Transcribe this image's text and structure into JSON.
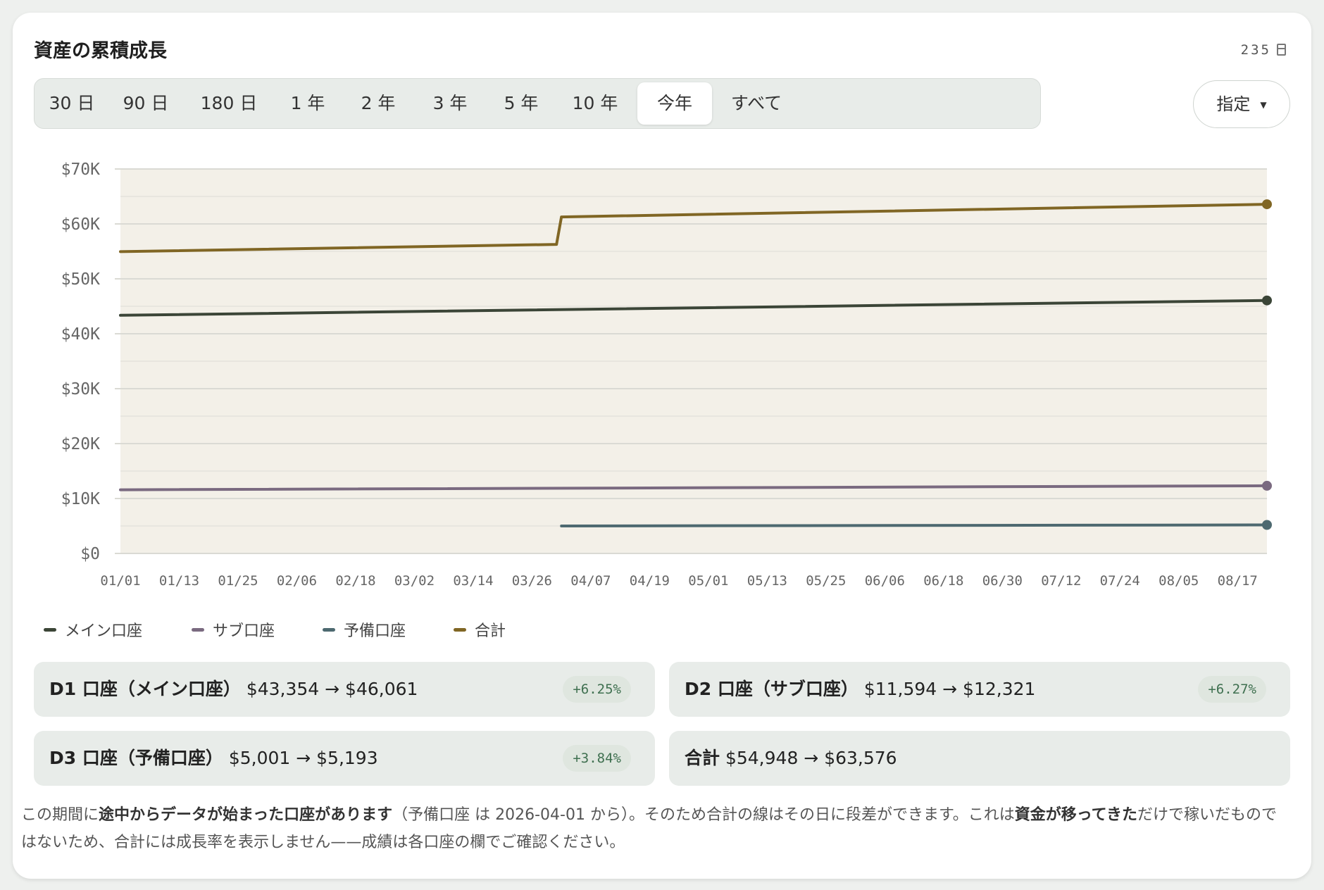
{
  "header": {
    "title": "資産の累積成長",
    "day_count": "235"
  },
  "range_tabs": [
    {
      "label": "30 日"
    },
    {
      "label": "90 日"
    },
    {
      "label": "180 日"
    },
    {
      "label": "1 年"
    },
    {
      "label": "2 年"
    },
    {
      "label": "3 年"
    },
    {
      "label": "5 年"
    },
    {
      "label": "10 年"
    },
    {
      "label": "今年",
      "active": true
    },
    {
      "label": "すべて"
    }
  ],
  "custom_button": {
    "label": "指定"
  },
  "colors": {
    "main": "#3b4537",
    "sub": "#7a6a80",
    "backup": "#4d6970",
    "total": "#806624",
    "fill": "#f3f0e8",
    "grid": "#dadad4"
  },
  "legend": [
    {
      "label": "メイン口座",
      "color": "#3b4537"
    },
    {
      "label": "サブ口座",
      "color": "#7a6a80"
    },
    {
      "label": "予備口座",
      "color": "#4d6970"
    },
    {
      "label": "合計",
      "color": "#806624"
    }
  ],
  "chart_data": {
    "type": "line",
    "ylim": [
      0,
      70000
    ],
    "y_ticks": [
      "$0",
      "$10K",
      "$20K",
      "$30K",
      "$40K",
      "$50K",
      "$60K",
      "$70K"
    ],
    "y_tick_values": [
      0,
      10000,
      20000,
      30000,
      40000,
      50000,
      60000,
      70000
    ],
    "x_ticks": [
      "01/01",
      "01/13",
      "01/25",
      "02/06",
      "02/18",
      "03/02",
      "03/14",
      "03/26",
      "04/07",
      "04/19",
      "05/01",
      "05/13",
      "05/25",
      "06/06",
      "06/18",
      "06/30",
      "07/12",
      "07/24",
      "08/05",
      "08/17"
    ],
    "grid": true,
    "series": [
      {
        "name": "メイン口座",
        "points": [
          [
            "01/01",
            43354
          ],
          [
            "08/23",
            46061
          ]
        ]
      },
      {
        "name": "サブ口座",
        "points": [
          [
            "01/01",
            11594
          ],
          [
            "08/23",
            12321
          ]
        ]
      },
      {
        "name": "予備口座",
        "points": [
          [
            "04/01",
            5001
          ],
          [
            "08/23",
            5193
          ]
        ]
      },
      {
        "name": "合計",
        "points": [
          [
            "01/01",
            54948
          ],
          [
            "03/31",
            56268
          ],
          [
            "04/01",
            61269
          ],
          [
            "08/23",
            63576
          ]
        ]
      }
    ]
  },
  "stats": [
    {
      "label": "D1 口座（メイン口座）",
      "range": "$43,354 → $46,061",
      "pct": "+6.25%"
    },
    {
      "label": "D2 口座（サブ口座）",
      "range": "$11,594 → $12,321",
      "pct": "+6.27%"
    },
    {
      "label": "D3 口座（予備口座）",
      "range": "$5,001 → $5,193",
      "pct": "+3.84%"
    },
    {
      "label": "合計",
      "range": "$54,948 → $63,576"
    }
  ],
  "note": {
    "p1": "この期間に",
    "b1": "途中からデータが始まった口座があります",
    "p2": "（予備口座 は 2026-04-01 から）。そのため合計の線はその日に段差ができます。これは",
    "b2": "資金が移ってきた",
    "p3": "だけで稼いだものではないため、合計には成長率を表示しません——成績は各口座の欄でご確認ください。"
  }
}
